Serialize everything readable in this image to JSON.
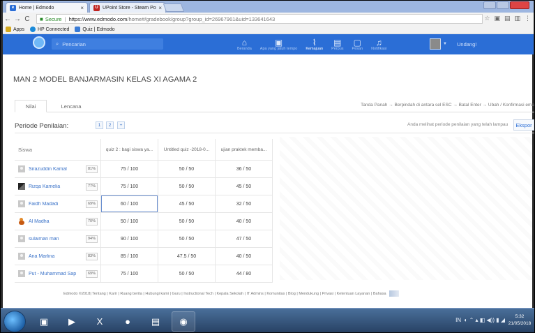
{
  "browser": {
    "tabs": [
      {
        "label": "Home | Edmodo",
        "favicon_color": "#2b6ed6"
      },
      {
        "label": "UPoint Store - Steam Po",
        "favicon_color": "#c0231f"
      }
    ],
    "secure_label": "Secure",
    "url_host": "https://www.edmodo.com",
    "url_path": "/home#/gradebook/group?group_id=26967961&uid=133641643",
    "bookmarks": [
      {
        "label": "Apps",
        "color": "#d4a81c"
      },
      {
        "label": "HP Connected",
        "color": "#1b8ad9"
      },
      {
        "label": "Quiz | Edmodo",
        "color": "#3a7bd5"
      }
    ]
  },
  "edmodo": {
    "search_placeholder": "Pencarian",
    "nav": [
      {
        "label": "Beranda",
        "icon": "home-icon"
      },
      {
        "label": "Apa yang jatuh tempo",
        "icon": "calendar-icon"
      },
      {
        "label": "Kemajuan",
        "icon": "progress-icon"
      },
      {
        "label": "Perpus",
        "icon": "library-icon"
      },
      {
        "label": "Pesan",
        "icon": "message-icon"
      },
      {
        "label": "Notifikasi",
        "icon": "bell-icon"
      }
    ],
    "active_nav": "Kemajuan",
    "invite_label": "Undang!"
  },
  "page": {
    "title": "MAN 2 MODEL BANJARMASIN KELAS XI AGAMA 2",
    "tabs": [
      "Nilai",
      "Lencana"
    ],
    "active_tab": "Nilai",
    "hint": "Tanda Panah → Berpindah di antara sel   ESC → Batal   Enter → Ubah / Konfirmasi ema",
    "period_label": "Periode Penilaian:",
    "periods": [
      "1",
      "2",
      "+"
    ],
    "period_note": "Anda melihat periode penilaian yang telah lampau",
    "export_label": "Ekspor"
  },
  "gradebook": {
    "student_header": "Siswa",
    "columns": [
      "quiz 2 : bagi siswa ya...",
      "Untitled quiz -2018-0...",
      "ujian praktek memba..."
    ],
    "rows": [
      {
        "name": "Sirazuddin Kamal",
        "pct": "81%",
        "avatar": "default",
        "scores": [
          "75 / 100",
          "50 / 50",
          "36 / 50"
        ]
      },
      {
        "name": "Rizqa Kamelia",
        "pct": "77%",
        "avatar": "photo",
        "scores": [
          "75 / 100",
          "50 / 50",
          "45 / 50"
        ]
      },
      {
        "name": "Faidh Madadi",
        "pct": "69%",
        "avatar": "default",
        "scores": [
          "60 / 100",
          "45 / 50",
          "32 / 50"
        ]
      },
      {
        "name": "Al Madha",
        "pct": "70%",
        "avatar": "duck",
        "scores": [
          "50 / 100",
          "50 / 50",
          "40 / 50"
        ]
      },
      {
        "name": "sulaiman man",
        "pct": "94%",
        "avatar": "default",
        "scores": [
          "90 / 100",
          "50 / 50",
          "47 / 50"
        ]
      },
      {
        "name": "Ana Marlina",
        "pct": "83%",
        "avatar": "default",
        "scores": [
          "85 / 100",
          "47.5 / 50",
          "40 / 50"
        ]
      },
      {
        "name": "Put - Muhammad Sap",
        "pct": "69%",
        "avatar": "default",
        "scores": [
          "75 / 100",
          "50 / 50",
          "44 / 80"
        ]
      }
    ],
    "focused_cell": [
      2,
      0
    ]
  },
  "footer": {
    "copyright": "Edmodo ©2018",
    "links": [
      "Tentang",
      "Karir",
      "Ruang berita",
      "Hubungi kami",
      "Guru",
      "Instructional Tech",
      "Kepala Sekolah",
      "IT Admins",
      "Komunitas",
      "Blog",
      "Mendukung",
      "Privasi",
      "Ketentuan Layanan",
      "Bahasa"
    ]
  },
  "taskbar": {
    "tray_text": "IN",
    "time": "5:32",
    "date": "21/05/2018"
  }
}
